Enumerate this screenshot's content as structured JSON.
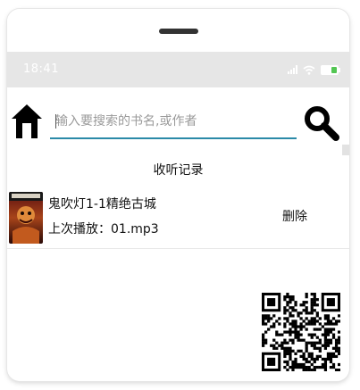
{
  "status_bar": {
    "time": "18:41"
  },
  "search": {
    "placeholder": "输入要搜索的书名,或作者",
    "value": ""
  },
  "icons": {
    "home": "home-icon",
    "search": "search-icon",
    "qr": "qr-code-icon"
  },
  "section": {
    "title": "收听记录"
  },
  "history": [
    {
      "title": "鬼吹灯1-1精绝古城",
      "last_played": "上次播放：01.mp3",
      "delete_label": "删除"
    }
  ],
  "colors": {
    "accent": "#2b8aa8",
    "status_bar_bg": "#e6e6e6",
    "battery": "#53c653"
  }
}
